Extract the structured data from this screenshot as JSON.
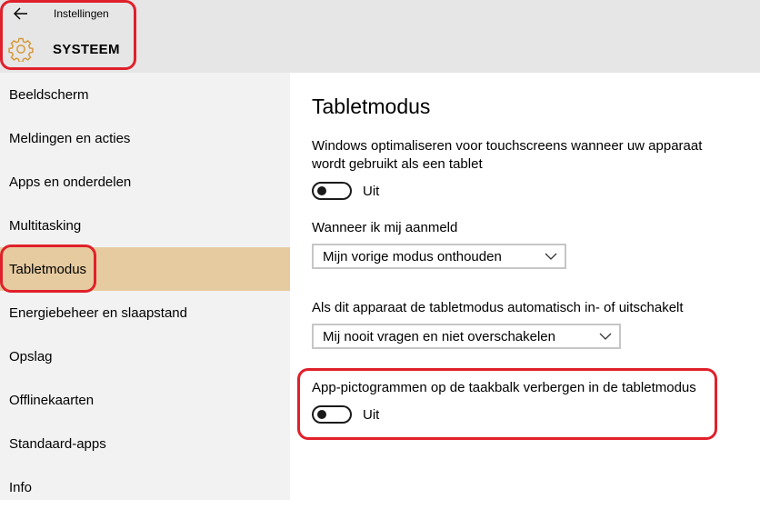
{
  "header": {
    "app_title": "Instellingen",
    "section_title": "SYSTEEM",
    "back_icon": "back-arrow-icon",
    "section_icon": "gear-icon",
    "accent_color": "#d79a3a"
  },
  "sidebar": {
    "active_color": "#e6cba0",
    "items": [
      {
        "label": "Beeldscherm"
      },
      {
        "label": "Meldingen en acties"
      },
      {
        "label": "Apps en onderdelen"
      },
      {
        "label": "Multitasking"
      },
      {
        "label": "Tabletmodus",
        "active": true
      },
      {
        "label": "Energiebeheer en slaapstand"
      },
      {
        "label": "Opslag"
      },
      {
        "label": "Offlinekaarten"
      },
      {
        "label": "Standaard-apps"
      },
      {
        "label": "Info"
      }
    ]
  },
  "content": {
    "title": "Tabletmodus",
    "optimize": {
      "description": "Windows optimaliseren voor touchscreens wanneer uw apparaat wordt gebruikt als een tablet",
      "state": "Uit"
    },
    "signin": {
      "label": "Wanneer ik mij aanmeld",
      "selected": "Mijn vorige modus onthouden"
    },
    "auto_switch": {
      "label": "Als dit apparaat de tabletmodus automatisch in- of uitschakelt",
      "selected": "Mij nooit vragen en niet overschakelen"
    },
    "hide_icons": {
      "description": "App-pictogrammen op de taakbalk verbergen in de tabletmodus",
      "state": "Uit"
    }
  },
  "annotation_color": "#e0202a"
}
